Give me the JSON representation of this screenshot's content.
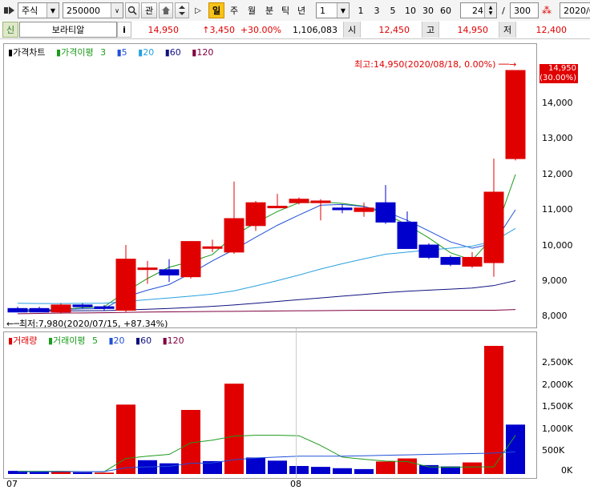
{
  "toolbar": {
    "market": "주식",
    "code": "250000",
    "fav_label": "관",
    "period_active": "일",
    "periods": [
      "주",
      "월",
      "분",
      "틱",
      "년"
    ],
    "interval": "1",
    "nums": [
      "1",
      "3",
      "5",
      "10",
      "30",
      "60"
    ],
    "count_current": "24",
    "count_sep": "/",
    "count_total": "300",
    "date": "2020/0"
  },
  "quote": {
    "badge": "신",
    "name": "보라티알",
    "info": "i",
    "price": "14,950",
    "change": "↑3,450",
    "pct": "+30.00%",
    "volume": "1,106,083",
    "open_label": "시",
    "open": "12,450",
    "high_label": "고",
    "high": "14,950",
    "low_label": "저",
    "low": "12,400"
  },
  "price_legend": {
    "title": "가격차트",
    "ma_label": "가격이평",
    "ma": [
      "3",
      "5",
      "20",
      "60",
      "120"
    ]
  },
  "volume_legend": {
    "title": "거래량",
    "ma_label": "거래이평",
    "ma": [
      "5",
      "20",
      "60",
      "120"
    ]
  },
  "annotations": {
    "high": "최고:14,950(2020/08/18, 0.00%)",
    "low": "최저:7,980(2020/07/15, +87.34%)"
  },
  "current_tag": {
    "price": "14,950",
    "pct": "(30.00%)"
  },
  "price_axis": [
    "14,000",
    "13,000",
    "12,000",
    "11,000",
    "10,000",
    "9,000",
    "8,000"
  ],
  "volume_axis": [
    "2,500K",
    "2,000K",
    "1,500K",
    "1,000K",
    "500K",
    "0K"
  ],
  "x_labels": [
    "07",
    "08"
  ],
  "colors": {
    "up": "#e00000",
    "down": "#0000cc",
    "ma3": "#1c9b1c",
    "ma5": "#2050d8",
    "ma20": "#28a0e0",
    "ma60": "#101080",
    "ma120": "#800040"
  },
  "chart_data": [
    {
      "type": "candlestick",
      "title": "가격차트",
      "ylim": [
        7700,
        15150
      ],
      "candles": [
        {
          "o": 8200,
          "h": 8250,
          "l": 8100,
          "c": 8100
        },
        {
          "o": 8200,
          "h": 8250,
          "l": 8100,
          "c": 8100
        },
        {
          "o": 8100,
          "h": 8350,
          "l": 8050,
          "c": 8300
        },
        {
          "o": 8300,
          "h": 8350,
          "l": 8200,
          "c": 8250
        },
        {
          "o": 8250,
          "h": 8300,
          "l": 8150,
          "c": 8200
        },
        {
          "o": 8150,
          "h": 10000,
          "l": 8100,
          "c": 9600
        },
        {
          "o": 9350,
          "h": 9550,
          "l": 8900,
          "c": 9350
        },
        {
          "o": 9300,
          "h": 9600,
          "l": 8950,
          "c": 9150
        },
        {
          "o": 9100,
          "h": 10050,
          "l": 9050,
          "c": 10100
        },
        {
          "o": 9950,
          "h": 10150,
          "l": 9800,
          "c": 9950
        },
        {
          "o": 9800,
          "h": 11800,
          "l": 9750,
          "c": 10750
        },
        {
          "o": 10550,
          "h": 11250,
          "l": 10400,
          "c": 11200
        },
        {
          "o": 11100,
          "h": 11450,
          "l": 11050,
          "c": 11100
        },
        {
          "o": 11200,
          "h": 11350,
          "l": 11150,
          "c": 11300
        },
        {
          "o": 11200,
          "h": 11300,
          "l": 10700,
          "c": 11250
        },
        {
          "o": 11050,
          "h": 11150,
          "l": 10900,
          "c": 11000
        },
        {
          "o": 10950,
          "h": 11200,
          "l": 10800,
          "c": 11050
        },
        {
          "o": 11200,
          "h": 11700,
          "l": 10600,
          "c": 10650
        },
        {
          "o": 10650,
          "h": 10950,
          "l": 9900,
          "c": 9900
        },
        {
          "o": 10000,
          "h": 10050,
          "l": 9600,
          "c": 9650
        },
        {
          "o": 9650,
          "h": 9700,
          "l": 9400,
          "c": 9450
        },
        {
          "o": 9400,
          "h": 9800,
          "l": 9350,
          "c": 9650
        },
        {
          "o": 9500,
          "h": 12450,
          "l": 9100,
          "c": 11500
        },
        {
          "o": 12450,
          "h": 14950,
          "l": 12400,
          "c": 14950
        }
      ],
      "series": [
        {
          "name": "3",
          "values": [
            8150,
            8130,
            8170,
            8220,
            8250,
            8680,
            9050,
            9370,
            9530,
            9730,
            10270,
            10630,
            10950,
            11200,
            11220,
            11180,
            11100,
            10880,
            10570,
            10200,
            9780,
            9570,
            10250,
            12000
          ]
        },
        {
          "name": "5",
          "values": [
            8180,
            8160,
            8170,
            8190,
            8200,
            8530,
            8720,
            8880,
            9200,
            9550,
            9870,
            10220,
            10560,
            10850,
            11130,
            11150,
            11090,
            10950,
            10700,
            10400,
            10090,
            9910,
            10050,
            11000
          ]
        },
        {
          "name": "20",
          "values": [
            8350,
            8340,
            8340,
            8345,
            8350,
            8400,
            8450,
            8500,
            8550,
            8610,
            8700,
            8840,
            8990,
            9150,
            9320,
            9470,
            9610,
            9740,
            9800,
            9860,
            9910,
            9970,
            10110,
            10470
          ]
        },
        {
          "name": "60",
          "values": [
            8120,
            8125,
            8130,
            8135,
            8140,
            8160,
            8180,
            8200,
            8230,
            8260,
            8300,
            8350,
            8400,
            8450,
            8500,
            8550,
            8600,
            8650,
            8690,
            8720,
            8750,
            8780,
            8850,
            8990
          ]
        },
        {
          "name": "120",
          "values": [
            8050,
            8060,
            8070,
            8075,
            8080,
            8090,
            8100,
            8105,
            8110,
            8115,
            8120,
            8125,
            8130,
            8135,
            8140,
            8145,
            8150,
            8150,
            8150,
            8150,
            8150,
            8150,
            8150,
            8170
          ]
        }
      ]
    },
    {
      "type": "bar",
      "title": "거래량",
      "unit": "K",
      "ylim": [
        0,
        2900
      ],
      "bars": [
        {
          "v": 70,
          "up": false
        },
        {
          "v": 60,
          "up": false
        },
        {
          "v": 60,
          "up": true
        },
        {
          "v": 40,
          "up": false
        },
        {
          "v": 30,
          "up": true
        },
        {
          "v": 1560,
          "up": true
        },
        {
          "v": 310,
          "up": false
        },
        {
          "v": 240,
          "up": false
        },
        {
          "v": 1440,
          "up": true
        },
        {
          "v": 290,
          "up": false
        },
        {
          "v": 2030,
          "up": true
        },
        {
          "v": 370,
          "up": false
        },
        {
          "v": 300,
          "up": false
        },
        {
          "v": 180,
          "up": false
        },
        {
          "v": 160,
          "up": false
        },
        {
          "v": 130,
          "up": false
        },
        {
          "v": 110,
          "up": false
        },
        {
          "v": 280,
          "up": true
        },
        {
          "v": 350,
          "up": true
        },
        {
          "v": 200,
          "up": false
        },
        {
          "v": 170,
          "up": false
        },
        {
          "v": 260,
          "up": true
        },
        {
          "v": 2880,
          "up": true
        },
        {
          "v": 1110,
          "up": false
        }
      ],
      "series": [
        {
          "name": "5",
          "values": [
            60,
            60,
            60,
            55,
            50,
            350,
            400,
            440,
            700,
            760,
            850,
            870,
            870,
            860,
            640,
            380,
            330,
            290,
            280,
            160,
            150,
            160,
            160,
            870,
            920
          ]
        },
        {
          "name": "20",
          "values": [
            50,
            50,
            55,
            55,
            55,
            140,
            160,
            170,
            240,
            250,
            320,
            360,
            380,
            400,
            400,
            400,
            410,
            420,
            430,
            440,
            450,
            460,
            470,
            500,
            560
          ]
        }
      ]
    }
  ]
}
